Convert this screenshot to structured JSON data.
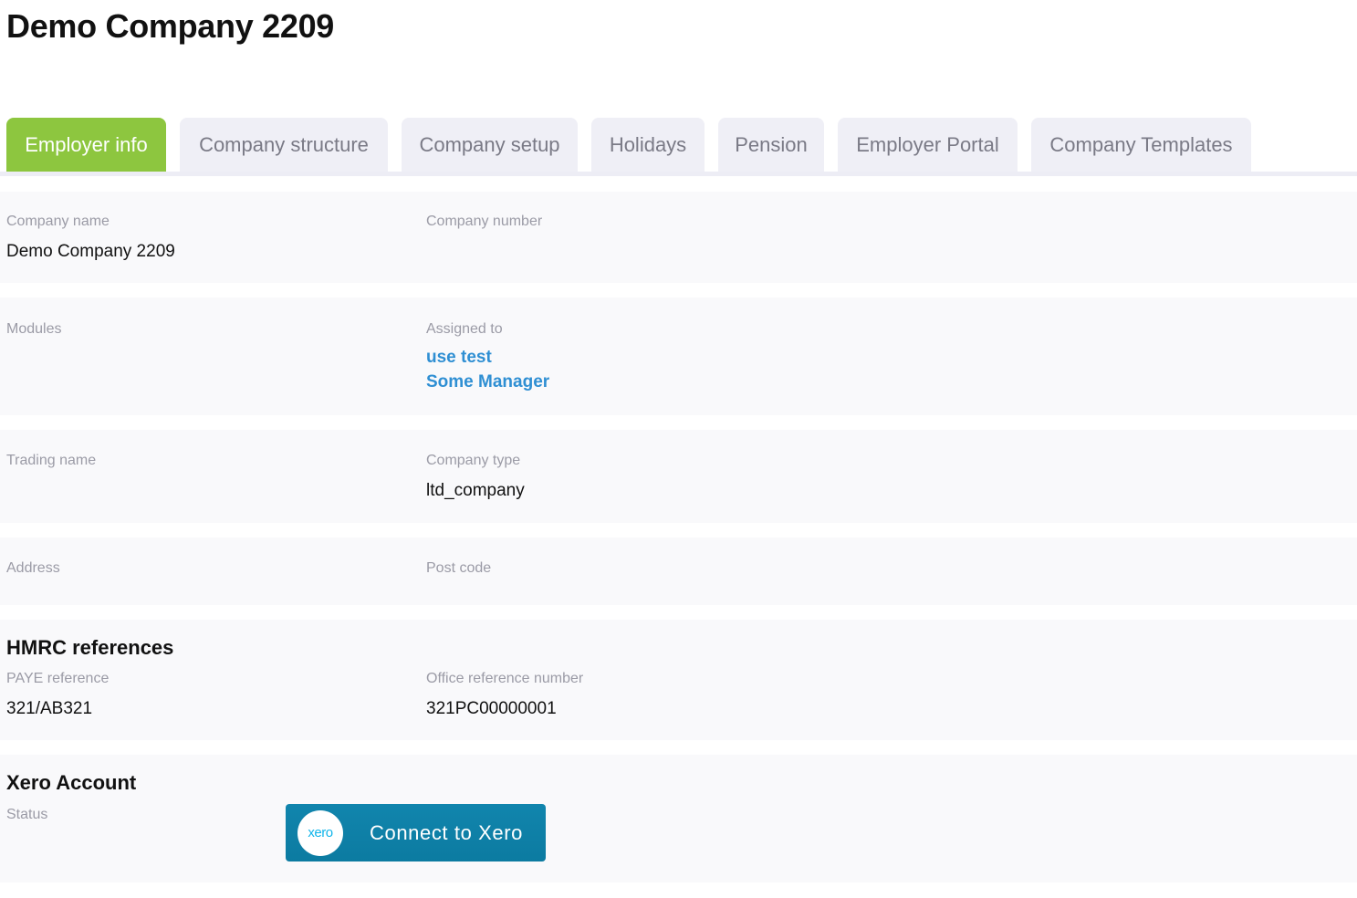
{
  "page": {
    "title": "Demo Company 2209"
  },
  "tabs": [
    {
      "label": "Employer info",
      "active": true
    },
    {
      "label": "Company structure",
      "active": false
    },
    {
      "label": "Company setup",
      "active": false
    },
    {
      "label": "Holidays",
      "active": false
    },
    {
      "label": "Pension",
      "active": false
    },
    {
      "label": "Employer Portal",
      "active": false
    },
    {
      "label": "Company Templates",
      "active": false
    }
  ],
  "colors": {
    "active_tab": "#8dc63f",
    "inactive_tab": "#efeff6",
    "link": "#2f8fd3",
    "xero_button": "#1185ad",
    "xero_brand": "#13b5ea"
  },
  "employer_info": {
    "company_name": {
      "label": "Company name",
      "value": "Demo Company 2209"
    },
    "company_number": {
      "label": "Company number",
      "value": ""
    },
    "modules": {
      "label": "Modules",
      "value": ""
    },
    "assigned_to": {
      "label": "Assigned to",
      "users": [
        "use test",
        "Some Manager"
      ]
    },
    "trading_name": {
      "label": "Trading name",
      "value": ""
    },
    "company_type": {
      "label": "Company type",
      "value": "ltd_company"
    },
    "address": {
      "label": "Address",
      "value": ""
    },
    "post_code": {
      "label": "Post code",
      "value": ""
    }
  },
  "hmrc": {
    "title": "HMRC references",
    "paye_reference": {
      "label": "PAYE reference",
      "value": "321/AB321"
    },
    "office_reference": {
      "label": "Office reference number",
      "value": "321PC00000001"
    }
  },
  "xero": {
    "title": "Xero Account",
    "status_label": "Status",
    "logo_text": "xero",
    "logo_icon": "xero-logo-icon",
    "connect_label": "Connect to Xero"
  }
}
